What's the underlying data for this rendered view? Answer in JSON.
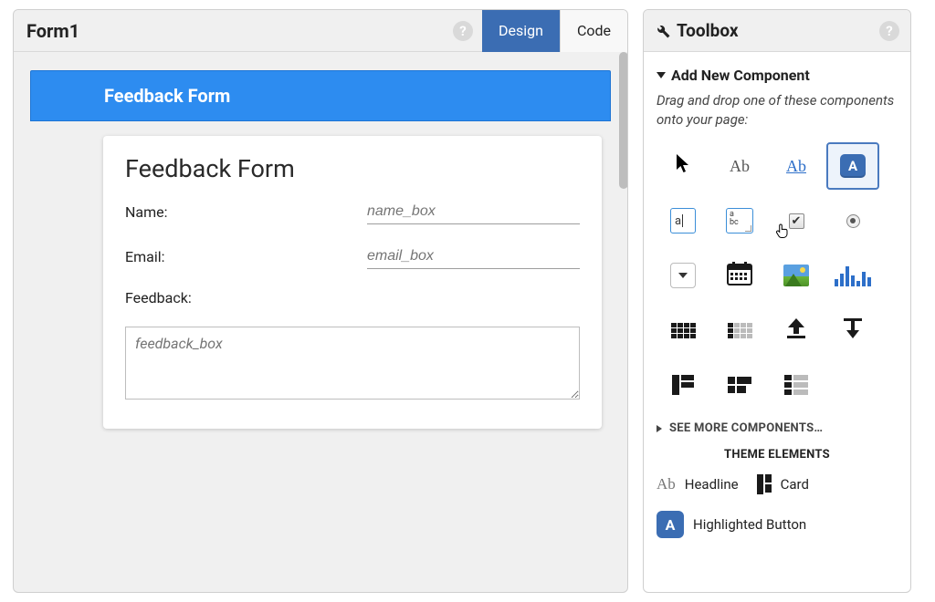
{
  "main": {
    "title": "Form1",
    "tabs": {
      "design": "Design",
      "code": "Code"
    },
    "banner": "Feedback Form",
    "card": {
      "title": "Feedback Form",
      "name_label": "Name:",
      "name_placeholder": "name_box",
      "email_label": "Email:",
      "email_placeholder": "email_box",
      "feedback_label": "Feedback:",
      "feedback_placeholder": "feedback_box"
    }
  },
  "toolbox": {
    "title": "Toolbox",
    "add_header": "Add New Component",
    "hint": "Drag and drop one of these components onto your page:",
    "see_more": "SEE MORE COMPONENTS…",
    "theme_heading": "THEME ELEMENTS",
    "theme": {
      "headline": "Headline",
      "card": "Card",
      "highlighted_button": "Highlighted Button"
    },
    "glyphs": {
      "ab": "Ab",
      "a": "A",
      "textbox_hint": "a",
      "textarea_hint": "a\nbc",
      "check": "✔"
    }
  }
}
